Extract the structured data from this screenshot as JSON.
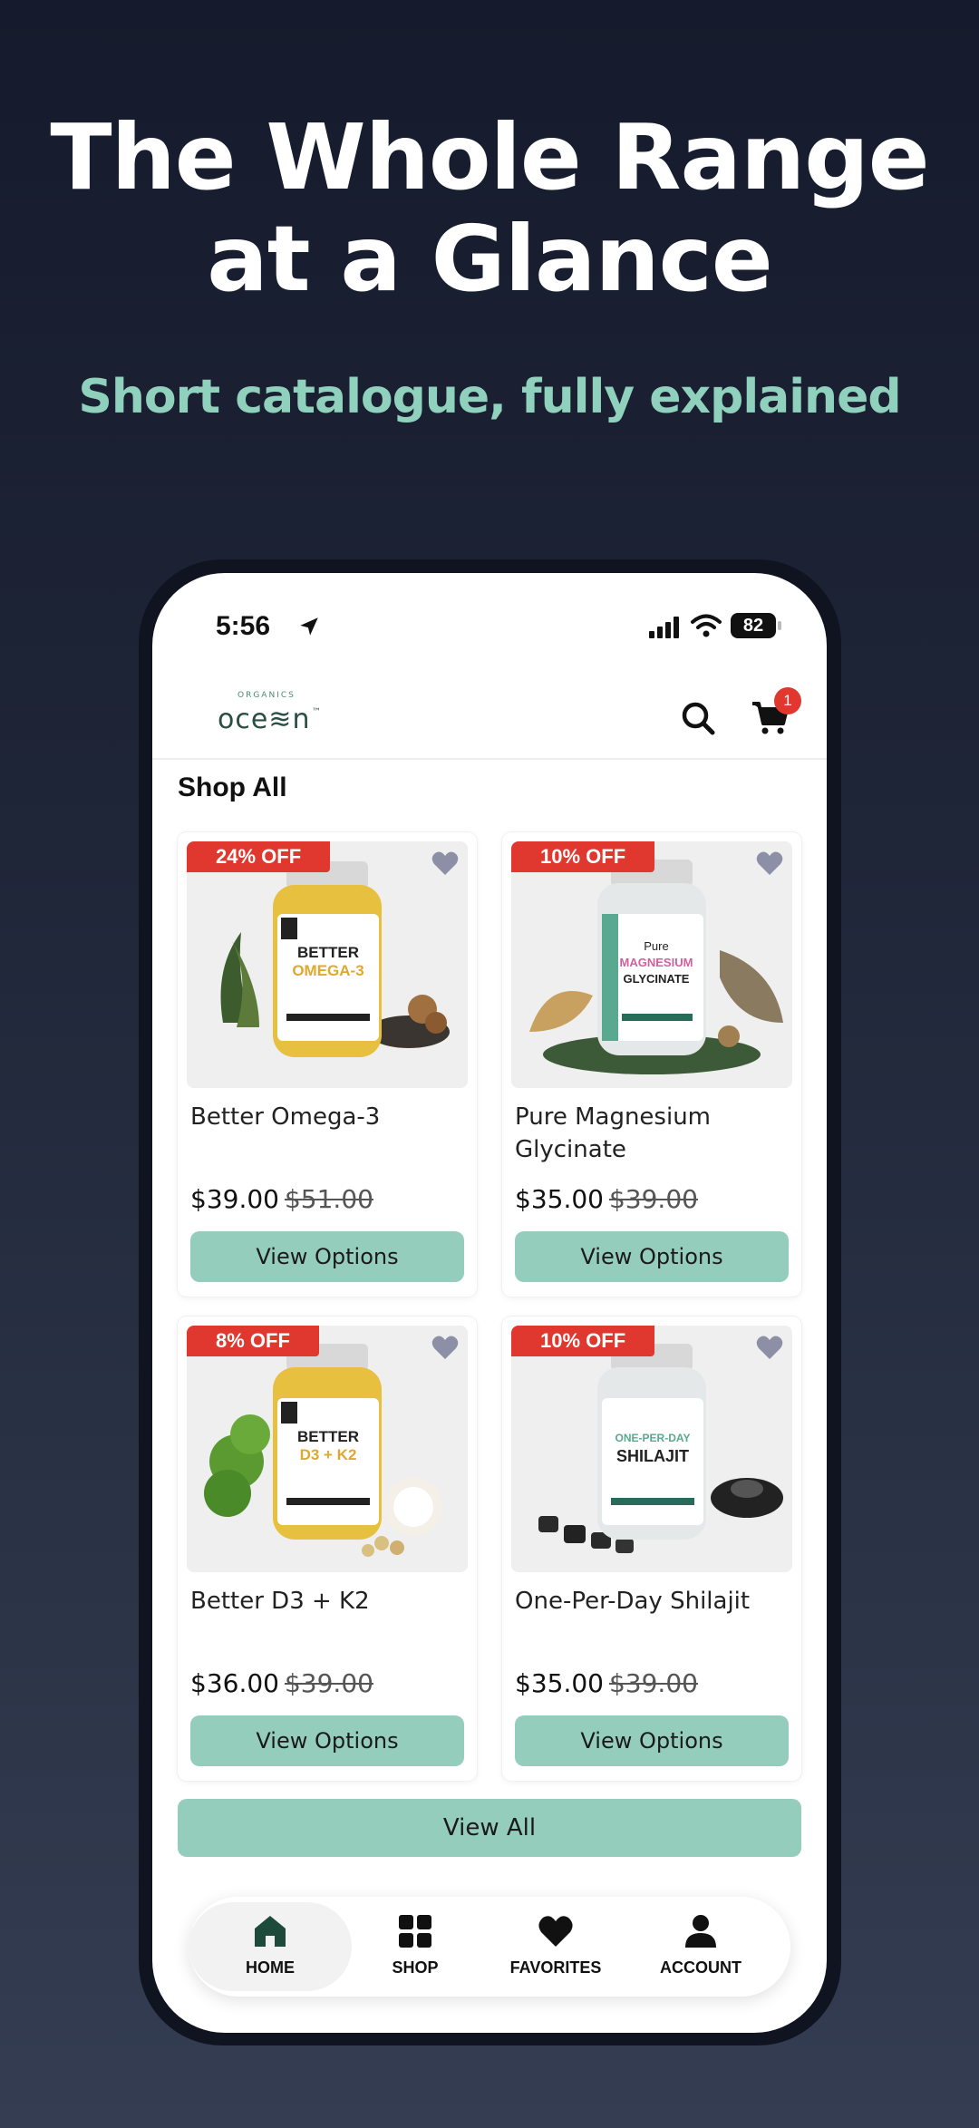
{
  "hero": {
    "title_line1": "The Whole Range",
    "title_line2": "at a Glance",
    "subtitle": "Short catalogue, fully explained"
  },
  "status_bar": {
    "time": "5:56",
    "battery": "82"
  },
  "app_bar": {
    "logo_small": "ORGANICS",
    "logo_main": "oce≋n",
    "logo_tm": "™",
    "cart_count": "1"
  },
  "shop": {
    "section_title": "Shop All",
    "products": [
      {
        "name": "Better Omega-3",
        "price": "$39.00",
        "old_price": "$51.00",
        "discount": "24% OFF",
        "button": "View Options"
      },
      {
        "name": "Pure Magnesium Glycinate",
        "price": "$35.00",
        "old_price": "$39.00",
        "discount": "10% OFF",
        "button": "View Options"
      },
      {
        "name": "Better D3 + K2",
        "price": "$36.00",
        "old_price": "$39.00",
        "discount": "8% OFF",
        "button": "View Options"
      },
      {
        "name": "One-Per-Day Shilajit",
        "price": "$35.00",
        "old_price": "$39.00",
        "discount": "10% OFF",
        "button": "View Options"
      }
    ],
    "view_all": "View All"
  },
  "tabs": [
    {
      "label": "HOME",
      "icon": "home-icon"
    },
    {
      "label": "SHOP",
      "icon": "grid-icon"
    },
    {
      "label": "FAVORITES",
      "icon": "heart-icon"
    },
    {
      "label": "ACCOUNT",
      "icon": "user-icon"
    }
  ],
  "colors": {
    "accent": "#95cdbd",
    "discount": "#e0382f",
    "subtitle": "#8fd1bd"
  }
}
